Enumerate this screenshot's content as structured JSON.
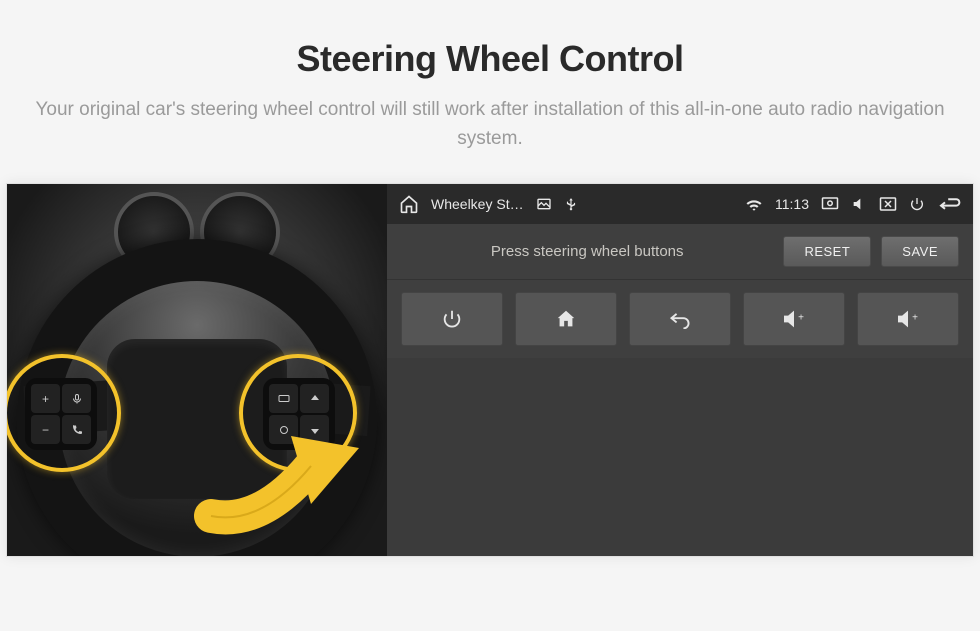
{
  "header": {
    "title": "Steering Wheel Control",
    "subtitle": "Your original car's steering wheel control will still work after installation of this all-in-one auto radio navigation system."
  },
  "statusbar": {
    "app_title": "Wheelkey St…",
    "time": "11:13",
    "icons": {
      "home": "home-icon",
      "picture": "picture-icon",
      "usb": "usb-icon",
      "wifi": "wifi-icon",
      "screenshot": "screenshot-icon",
      "volume": "volume-icon",
      "close_app": "close-app-icon",
      "power": "power-icon",
      "back": "back-nav-icon"
    }
  },
  "config": {
    "instruction": "Press steering wheel buttons",
    "reset_label": "RESET",
    "save_label": "SAVE",
    "buttons": [
      {
        "name": "power-button",
        "icon": "power-icon"
      },
      {
        "name": "home-button",
        "icon": "home-icon"
      },
      {
        "name": "back-button",
        "icon": "undo-icon"
      },
      {
        "name": "vol-up-button-1",
        "icon": "volume-up-icon",
        "label": "+"
      },
      {
        "name": "vol-up-button-2",
        "icon": "volume-up-icon",
        "label": "+"
      }
    ]
  },
  "wheel": {
    "left_pad": [
      "+",
      "voice",
      "−",
      "phone"
    ],
    "right_pad": [
      "src",
      "up",
      "cycle",
      "down"
    ],
    "arrow_color": "#f3c22b",
    "highlight_color": "#f3c22b"
  }
}
